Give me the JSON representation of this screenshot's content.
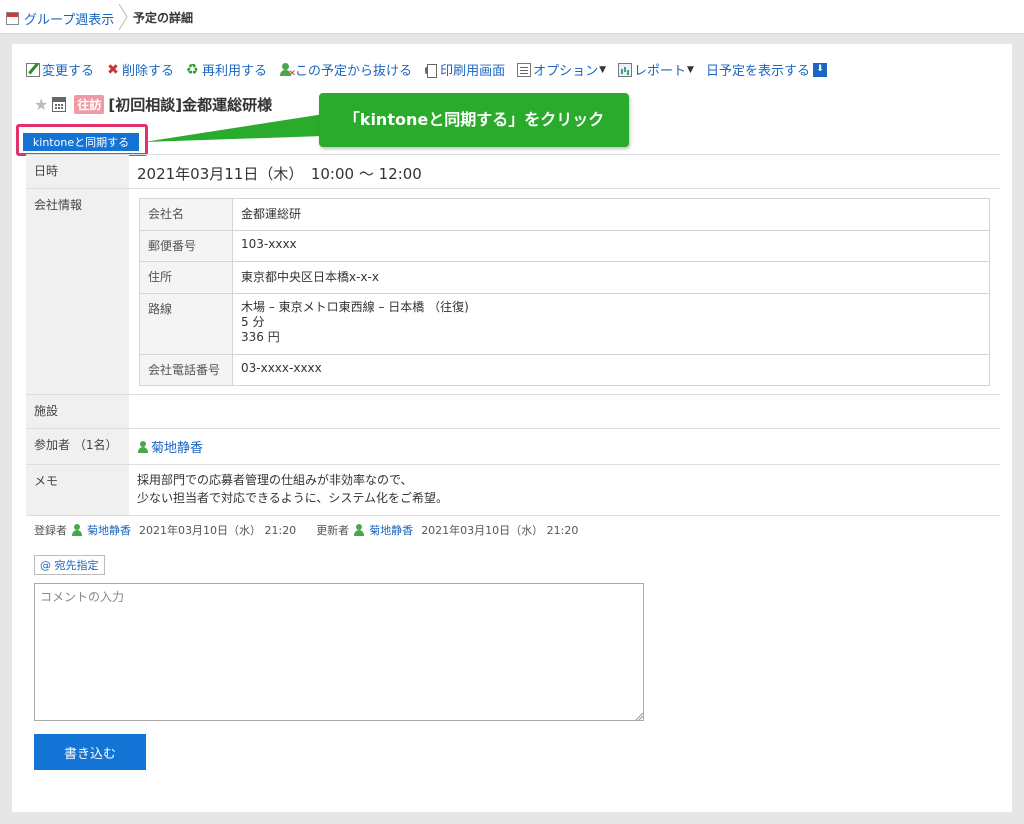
{
  "breadcrumb": {
    "home_label": "グループ週表示",
    "current_label": "予定の詳細"
  },
  "toolbar": {
    "edit": "変更する",
    "delete": "削除する",
    "reuse": "再利用する",
    "leave": "この予定から抜ける",
    "print": "印刷用画面",
    "options": "オプション",
    "report": "レポート",
    "day_view": "日予定を表示する"
  },
  "event": {
    "tag": "往訪",
    "title": "[初回相談]金都運総研様"
  },
  "callout": {
    "text": "「kintoneと同期する」をクリック",
    "color": "#2bab2b"
  },
  "kintone_button": {
    "label": "kintoneと同期する",
    "highlight_color": "#e0336a"
  },
  "details": {
    "datetime_label": "日時",
    "datetime_value": "2021年03月11日（木）　10:00 ～ 12:00",
    "company_label": "会社情報",
    "company": {
      "name_label": "会社名",
      "name_value": "金都運総研",
      "zip_label": "郵便番号",
      "zip_value": "103-xxxx",
      "address_label": "住所",
      "address_value": "東京都中央区日本橋x-x-x",
      "route_label": "路線",
      "route_line1": "木場 – 東京メトロ東西線 – 日本橋 （往復)",
      "route_line2": "5 分",
      "route_line3": "336 円",
      "phone_label": "会社電話番号",
      "phone_value": "03-xxxx-xxxx"
    },
    "facility_label": "施設",
    "attendees_label": "参加者 （1名）",
    "attendee_name": "菊地静香",
    "memo_label": "メモ",
    "memo_line1": "採用部門での応募者管理の仕組みが非効率なので、",
    "memo_line2": "少ない担当者で対応できるように、システム化をご希望。"
  },
  "meta": {
    "registered_label": "登録者",
    "registered_user": "菊地静香",
    "registered_time": "2021年03月10日（水） 21:20",
    "updated_label": "更新者",
    "updated_user": "菊地静香",
    "updated_time": "2021年03月10日（水） 21:20"
  },
  "comment": {
    "mention_button": "@ 宛先指定",
    "placeholder": "コメントの入力",
    "submit_label": "書き込む"
  },
  "colors": {
    "link": "#1a66c2",
    "primary_button": "#1474d6",
    "tag": "#f19aa5"
  }
}
